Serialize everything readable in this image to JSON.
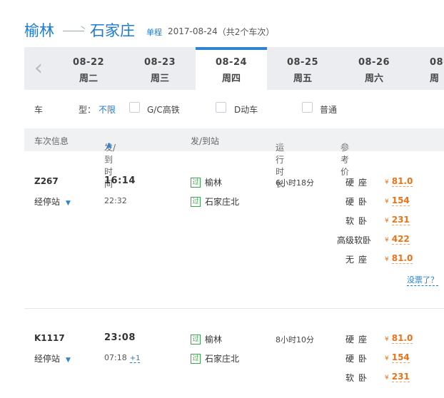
{
  "route": {
    "from": "榆林",
    "to": "石家庄",
    "trip_type": "单程",
    "date": "2017-08-24",
    "count_text": "（共2个车次）"
  },
  "dates": [
    {
      "date": "08-22",
      "weekday": "周二",
      "active": false
    },
    {
      "date": "08-23",
      "weekday": "周三",
      "active": false
    },
    {
      "date": "08-24",
      "weekday": "周四",
      "active": true
    },
    {
      "date": "08-25",
      "weekday": "周五",
      "active": false
    },
    {
      "date": "08-26",
      "weekday": "周六",
      "active": false
    },
    {
      "date": "08-",
      "weekday": "周",
      "active": false
    }
  ],
  "filter": {
    "label_left": "车",
    "label_right": "型：",
    "any": "不限",
    "options": [
      "G/C高铁",
      "D动车",
      "普通"
    ]
  },
  "headers": {
    "train_info": "车次信息",
    "times": "发/到时间",
    "stations": "发/到站",
    "duration": "运行时长",
    "price": "参考价"
  },
  "trains": [
    {
      "number": "Z267",
      "stops_label": "经停站",
      "depart": "16:14",
      "arrive": "22:32",
      "plus_day": "",
      "from_tag": "过",
      "from_station": "榆林",
      "to_tag": "过",
      "to_station": "石家庄北",
      "duration": "6小时18分",
      "seats": [
        {
          "name": "硬座",
          "yen": "¥",
          "price": "81.0"
        },
        {
          "name": "硬卧",
          "yen": "¥",
          "price": "154"
        },
        {
          "name": "软卧",
          "yen": "¥",
          "price": "231"
        },
        {
          "name": "高级软卧",
          "yen": "¥",
          "price": "422"
        },
        {
          "name": "无座",
          "yen": "¥",
          "price": "81.0"
        }
      ],
      "no_ticket": "没票了？"
    },
    {
      "number": "K1117",
      "stops_label": "经停站",
      "depart": "23:08",
      "arrive": "07:18",
      "plus_day": "+1",
      "from_tag": "过",
      "from_station": "榆林",
      "to_tag": "过",
      "to_station": "石家庄北",
      "duration": "8小时10分",
      "seats": [
        {
          "name": "硬座",
          "yen": "¥",
          "price": "81.0"
        },
        {
          "name": "硬卧",
          "yen": "¥",
          "price": "154"
        },
        {
          "name": "软卧",
          "yen": "¥",
          "price": "231"
        }
      ]
    }
  ]
}
